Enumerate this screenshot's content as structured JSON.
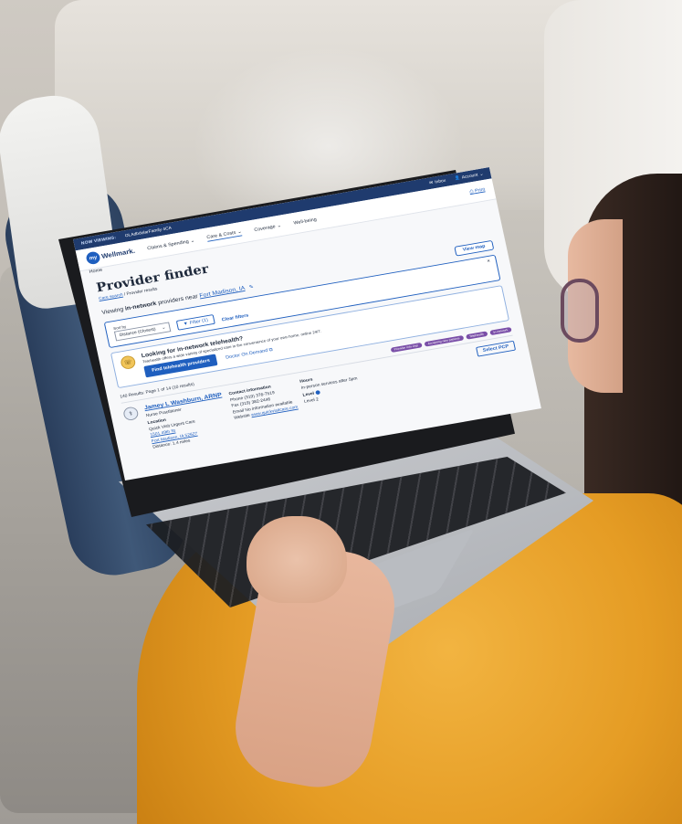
{
  "topbar": {
    "viewing_label": "NOW VIEWING:",
    "viewing_value": "OLAdbdolarFamily 4CA",
    "inbox": "Inbox",
    "account": "Account"
  },
  "nav": {
    "logo_my": "my",
    "logo_brand": "Wellmark.",
    "home": "Home",
    "items": [
      "Claims & Spending",
      "Care & Costs",
      "Coverage",
      "Well-being"
    ],
    "print": "Print"
  },
  "page": {
    "title": "Provider finder",
    "crumb_link": "Care search",
    "crumb_current": "/ Provider results",
    "viewing_prefix": "Viewing",
    "viewing_bold": "in-network",
    "viewing_middle": "providers near",
    "viewing_location": "Fort Madison, IA",
    "view_map": "View map"
  },
  "filters": {
    "sort_label": "Sort by",
    "sort_value": "Distance (Closest)",
    "filter_button": "Filter (1)",
    "clear": "Clear filters"
  },
  "telehealth": {
    "heading": "Looking for in-network telehealth?",
    "body": "Telehealth offers a wide variety of specialized care in the convenience of your own home, online 24/7.",
    "find_button": "Find telehealth providers",
    "doctor_on_demand": "Doctor On Demand"
  },
  "results": {
    "count": "140 Results: Page 1 of 14 (10 results)",
    "chips": [
      "Provider info chip",
      "Accepting new patients",
      "Telehealth",
      "In-network"
    ]
  },
  "provider": {
    "name": "Jamey L Washburn, ARNP",
    "role": "Nurse Practitioner",
    "location_heading": "Location",
    "location_name": "Quick Visit Urgent Care",
    "address_line1": "1501 49th St",
    "address_line2": "Fort Madison, IA 52627",
    "distance": "Distance: 1.4 miles",
    "contact_heading": "Contact information",
    "phone": "Phone  (319) 376-7519",
    "fax": "Fax  (319) 382-2446",
    "email": "Email  No information available",
    "website_label": "Website",
    "website_value": "www.quickvisitcare.com",
    "hours_heading": "Hours",
    "hours_value": "In-person services after 5pm",
    "level_heading": "Level",
    "level_value": "Level 2",
    "select_pcp": "Select PCP"
  }
}
